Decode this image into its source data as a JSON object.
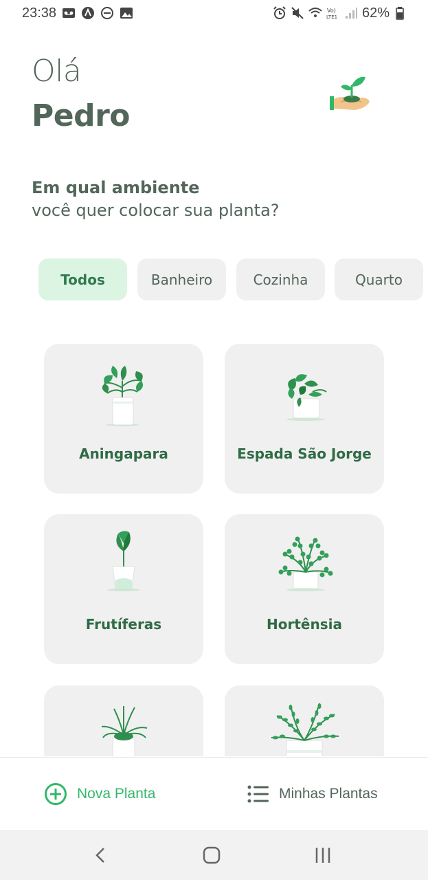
{
  "status_bar": {
    "time": "23:38",
    "battery": "62%",
    "left_icons": [
      "voicemail-icon",
      "app-icon",
      "do-not-disturb-icon",
      "gallery-icon"
    ],
    "right_icons": [
      "alarm-icon",
      "mute-icon",
      "wifi-icon",
      "volte-icon",
      "signal-icon",
      "battery-icon"
    ]
  },
  "header": {
    "greeting": "Olá",
    "name": "Pedro",
    "illustration": "hand-holding-plant-icon"
  },
  "question": {
    "title": "Em qual ambiente",
    "subtitle": "você quer colocar sua planta?"
  },
  "filters": [
    {
      "label": "Todos",
      "active": true
    },
    {
      "label": "Banheiro",
      "active": false
    },
    {
      "label": "Cozinha",
      "active": false
    },
    {
      "label": "Quarto",
      "active": false
    }
  ],
  "plants": [
    {
      "name": "Aningapara",
      "icon": "aningapara-plant-icon"
    },
    {
      "name": "Espada São Jorge",
      "icon": "espada-sao-jorge-plant-icon"
    },
    {
      "name": "Frutíferas",
      "icon": "frutiferas-plant-icon"
    },
    {
      "name": "Hortênsia",
      "icon": "hortensia-plant-icon"
    },
    {
      "name": "",
      "icon": "spider-plant-icon"
    },
    {
      "name": "",
      "icon": "fern-plant-icon"
    }
  ],
  "tabbar": {
    "new_plant": "Nova Planta",
    "my_plants": "Minhas Plantas"
  },
  "colors": {
    "green": "#32b768",
    "dark_green_text": "#52665a",
    "card_bg": "#f0f0f0",
    "active_chip_bg": "#dcf5e3"
  }
}
